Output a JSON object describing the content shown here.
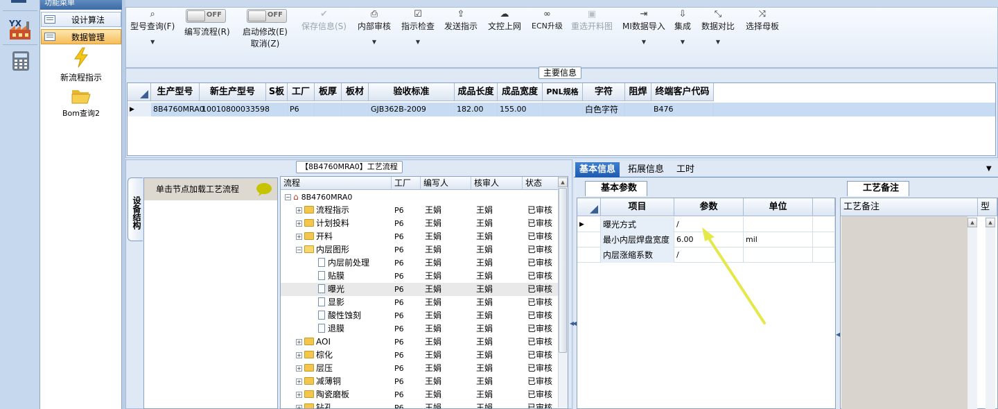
{
  "nav": {
    "header": "功能菜单",
    "items": [
      {
        "label": "设计算法",
        "active": false
      },
      {
        "label": "数据管理",
        "active": true
      }
    ],
    "tools": [
      {
        "label": "新流程指示",
        "icon": "lightning-icon"
      },
      {
        "label": "Bom查询2",
        "icon": "folder-open-icon"
      }
    ]
  },
  "rail": {
    "logo_text": "YX"
  },
  "toolbar": {
    "buttons": [
      {
        "label": "型号查询(F)",
        "icon": "search-icon",
        "dropdown": true,
        "disabled": false
      },
      {
        "label": "编写流程(R)",
        "toggle": "OFF",
        "disabled": false
      },
      {
        "label": "启动修改(E)",
        "label2": "取消(Z)",
        "toggle": "OFF",
        "disabled": false
      },
      {
        "label": "保存信息(S)",
        "icon": "check-icon",
        "disabled": true
      },
      {
        "label": "内部审核",
        "icon": "printer-icon",
        "dropdown": true,
        "disabled": false
      },
      {
        "label": "指示检查",
        "icon": "checkbox-icon",
        "dropdown": true,
        "disabled": false
      },
      {
        "label": "发送指示",
        "icon": "upload-icon",
        "disabled": false
      },
      {
        "label": "文控上网",
        "icon": "cloud-upload-icon",
        "disabled": false
      },
      {
        "label": "ECN升级",
        "icon": "binoculars-icon",
        "disabled": false
      },
      {
        "label": "重选开料图",
        "icon": "image-icon",
        "disabled": true
      },
      {
        "label": "MI数据导入",
        "icon": "sign-in-icon",
        "dropdown": true,
        "disabled": false
      },
      {
        "label": "集成",
        "icon": "download-icon",
        "dropdown": true,
        "disabled": false
      },
      {
        "label": "数据对比",
        "icon": "compress-icon",
        "dropdown": true,
        "disabled": false
      },
      {
        "label": "选择母板",
        "icon": "shuffle-icon",
        "disabled": false
      }
    ]
  },
  "main_info": {
    "title": "主要信息",
    "columns": [
      "生产型号",
      "新生产型号",
      "S板",
      "工厂",
      "板厚",
      "板材",
      "验收标准",
      "成品长度",
      "成品宽度",
      "PNL规格",
      "字符",
      "阻焊",
      "终端客户代码"
    ],
    "row": [
      "8B4760MRA0",
      "10010800033598",
      "",
      "P6",
      "",
      "",
      "GJB362B-2009",
      "182.00",
      "155.00",
      "",
      "白色字符",
      "",
      "B476"
    ]
  },
  "flow": {
    "title": "【8B4760MRA0】工艺流程",
    "side_tab": "设备结构",
    "eq_hint": "单击节点加载工艺流程",
    "columns": [
      "流程",
      "工厂",
      "编写人",
      "核审人",
      "状态"
    ],
    "root": "8B4760MRA0",
    "rows": [
      {
        "name": "流程指示",
        "type": "folder",
        "level": 1,
        "factory": "P6",
        "writer": "王娟",
        "reviewer": "王娟",
        "status": "已审核"
      },
      {
        "name": "计划投料",
        "type": "folder",
        "level": 1,
        "factory": "P6",
        "writer": "王娟",
        "reviewer": "王娟",
        "status": "已审核"
      },
      {
        "name": "开料",
        "type": "folder",
        "level": 1,
        "factory": "P6",
        "writer": "王娟",
        "reviewer": "王娟",
        "status": "已审核"
      },
      {
        "name": "内层图形",
        "type": "folder-open",
        "level": 1,
        "factory": "P6",
        "writer": "王娟",
        "reviewer": "王娟",
        "status": "已审核"
      },
      {
        "name": "内层前处理",
        "type": "doc",
        "level": 2,
        "factory": "P6",
        "writer": "王娟",
        "reviewer": "王娟",
        "status": "已审核"
      },
      {
        "name": "贴膜",
        "type": "doc",
        "level": 2,
        "factory": "P6",
        "writer": "王娟",
        "reviewer": "王娟",
        "status": "已审核"
      },
      {
        "name": "曝光",
        "type": "doc",
        "level": 2,
        "factory": "P6",
        "writer": "王娟",
        "reviewer": "王娟",
        "status": "已审核",
        "selected": true
      },
      {
        "name": "显影",
        "type": "doc",
        "level": 2,
        "factory": "P6",
        "writer": "王娟",
        "reviewer": "王娟",
        "status": "已审核"
      },
      {
        "name": "酸性蚀刻",
        "type": "doc",
        "level": 2,
        "factory": "P6",
        "writer": "王娟",
        "reviewer": "王娟",
        "status": "已审核"
      },
      {
        "name": "退膜",
        "type": "doc",
        "level": 2,
        "factory": "P6",
        "writer": "王娟",
        "reviewer": "王娟",
        "status": "已审核"
      },
      {
        "name": "AOI",
        "type": "folder",
        "level": 1,
        "factory": "P6",
        "writer": "王娟",
        "reviewer": "王娟",
        "status": "已审核"
      },
      {
        "name": "棕化",
        "type": "folder",
        "level": 1,
        "factory": "P6",
        "writer": "王娟",
        "reviewer": "王娟",
        "status": "已审核"
      },
      {
        "name": "层压",
        "type": "folder",
        "level": 1,
        "factory": "P6",
        "writer": "王娟",
        "reviewer": "王娟",
        "status": "已审核"
      },
      {
        "name": "减薄铜",
        "type": "folder",
        "level": 1,
        "factory": "P6",
        "writer": "王娟",
        "reviewer": "王娟",
        "status": "已审核"
      },
      {
        "name": "陶瓷磨板",
        "type": "folder",
        "level": 1,
        "factory": "P6",
        "writer": "王娟",
        "reviewer": "王娟",
        "status": "已审核"
      },
      {
        "name": "钻孔",
        "type": "folder",
        "level": 1,
        "factory": "P6",
        "writer": "王娟",
        "reviewer": "王娟",
        "status": "已审核"
      }
    ]
  },
  "detail": {
    "tabs": [
      "基本信息",
      "拓展信息",
      "工时"
    ],
    "subtab": "基本参数",
    "columns": [
      "项目",
      "参数",
      "单位"
    ],
    "rows": [
      {
        "item": "曝光方式",
        "param": "/",
        "unit": ""
      },
      {
        "item": "最小内层焊盘宽度",
        "param": "6.00",
        "unit": "mil"
      },
      {
        "item": "内层涨缩系数",
        "param": "/",
        "unit": ""
      }
    ],
    "note_tab": "工艺备注",
    "note_col": "工艺备注",
    "note_col2": "型"
  },
  "colors": {
    "accent": "#1d5bb0",
    "selected_row": "#c7dbf3",
    "arrow": "#e5e84a"
  }
}
